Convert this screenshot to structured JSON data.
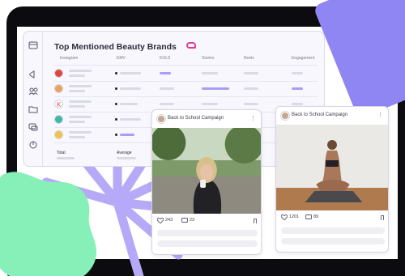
{
  "dashboard": {
    "title": "Top Mentioned Beauty Brands",
    "columns": [
      "Instagram",
      "EMV",
      "KOLS",
      "Stories",
      "Reels",
      "Engagement"
    ],
    "footer": {
      "total_label": "Total",
      "average_label": "Average"
    },
    "sidebar_icons": [
      "megaphone-icon",
      "users-icon",
      "folder-icon",
      "chat-icon",
      "chart-icon"
    ],
    "brand_avatar_colors": [
      "#e0463a",
      "#e8a45a",
      "#d9434f",
      "#3cb8a6",
      "#f2c24a"
    ],
    "accent_color": "#a89ef6"
  },
  "posts": [
    {
      "title": "Back to School Campaign",
      "likes": "243",
      "comments": "23"
    },
    {
      "title": "Back to School Campaign",
      "likes": "1201",
      "comments": "89"
    }
  ],
  "colors": {
    "frame": "#0c0c10",
    "purple": "#8f86f4",
    "lilac": "#b6aaf8",
    "mint": "#86f0b8"
  }
}
